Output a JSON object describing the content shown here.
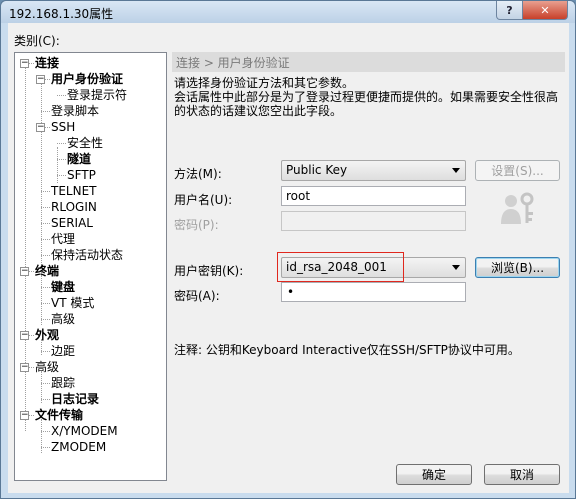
{
  "window": {
    "title": "192.168.1.30属性",
    "help_label": "?",
    "close_label": "✕"
  },
  "category_label": "类别(C):",
  "tree": [
    {
      "label": "连接",
      "bold": true,
      "expander": "−"
    },
    {
      "label": "用户身份验证",
      "bold": true,
      "expander": "−",
      "selected": true
    },
    {
      "label": "登录提示符",
      "bold": false
    },
    {
      "label": "登录脚本",
      "bold": false
    },
    {
      "label": "SSH",
      "bold": false,
      "expander": "−"
    },
    {
      "label": "安全性",
      "bold": false
    },
    {
      "label": "隧道",
      "bold": true
    },
    {
      "label": "SFTP",
      "bold": false
    },
    {
      "label": "TELNET",
      "bold": false
    },
    {
      "label": "RLOGIN",
      "bold": false
    },
    {
      "label": "SERIAL",
      "bold": false
    },
    {
      "label": "代理",
      "bold": false
    },
    {
      "label": "保持活动状态",
      "bold": false
    },
    {
      "label": "终端",
      "bold": true,
      "expander": "−"
    },
    {
      "label": "键盘",
      "bold": true
    },
    {
      "label": "VT 模式",
      "bold": false
    },
    {
      "label": "高级",
      "bold": false
    },
    {
      "label": "外观",
      "bold": true,
      "expander": "−"
    },
    {
      "label": "边距",
      "bold": false
    },
    {
      "label": "高级",
      "bold": false,
      "expander": "−"
    },
    {
      "label": "跟踪",
      "bold": false
    },
    {
      "label": "日志记录",
      "bold": true
    },
    {
      "label": "文件传输",
      "bold": true,
      "expander": "−"
    },
    {
      "label": "X/YMODEM",
      "bold": false
    },
    {
      "label": "ZMODEM",
      "bold": false
    }
  ],
  "panel": {
    "header": "连接 > 用户身份验证",
    "description_line1": "请选择身份验证方法和其它参数。",
    "description_line2": "会话属性中此部分是为了登录过程更便捷而提供的。如果需要安全性很高的状态的话建议您空出此字段。",
    "method_label": "方法(M):",
    "method_value": "Public Key",
    "settings_button": "设置(S)...",
    "username_label": "用户名(U):",
    "username_value": "root",
    "password_label_disabled": "密码(P):",
    "userkey_label": "用户密钥(K):",
    "userkey_value": "id_rsa_2048_001",
    "browse_button": "浏览(B)...",
    "passphrase_label": "密码(A):",
    "passphrase_value": "•",
    "note": "注释: 公钥和Keyboard Interactive仅在SSH/SFTP协议中可用。",
    "user_key_icon": "user-key-icon"
  },
  "footer": {
    "ok_button": "确定",
    "cancel_button": "取消"
  }
}
